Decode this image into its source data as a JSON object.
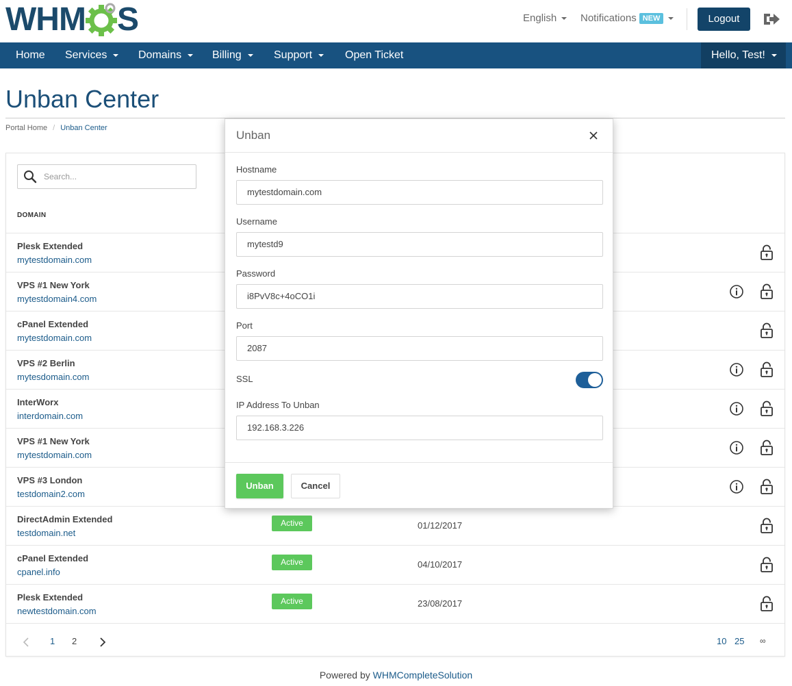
{
  "header": {
    "logo_text_left": "WHM",
    "logo_text_right": "S",
    "language": "English",
    "notifications": "Notifications",
    "new_badge": "NEW",
    "logout": "Logout"
  },
  "nav": {
    "items": [
      {
        "label": "Home",
        "dropdown": false
      },
      {
        "label": "Services",
        "dropdown": true
      },
      {
        "label": "Domains",
        "dropdown": true
      },
      {
        "label": "Billing",
        "dropdown": true
      },
      {
        "label": "Support",
        "dropdown": true
      },
      {
        "label": "Open Ticket",
        "dropdown": false
      }
    ],
    "user": "Hello, Test!"
  },
  "page": {
    "title": "Unban Center",
    "breadcrumb": [
      "Portal Home",
      "Unban Center"
    ]
  },
  "table": {
    "search_placeholder": "Search...",
    "column_domain": "DOMAIN",
    "rows": [
      {
        "name": "Plesk Extended",
        "domain": "mytestdomain.com",
        "status": "",
        "date": "",
        "info": false
      },
      {
        "name": "VPS #1 New York",
        "domain": "mytestdomain4.com",
        "status": "",
        "date": "",
        "info": true
      },
      {
        "name": "cPanel Extended",
        "domain": "mytestdomain.com",
        "status": "",
        "date": "",
        "info": false
      },
      {
        "name": "VPS #2 Berlin",
        "domain": "mytesdomain.com",
        "status": "",
        "date": "",
        "info": true
      },
      {
        "name": "InterWorx",
        "domain": "interdomain.com",
        "status": "",
        "date": "",
        "info": true
      },
      {
        "name": "VPS #1 New York",
        "domain": "mytestdomain.com",
        "status": "",
        "date": "",
        "info": true
      },
      {
        "name": "VPS #3 London",
        "domain": "testdomain2.com",
        "status": "",
        "date": "",
        "info": true
      },
      {
        "name": "DirectAdmin Extended",
        "domain": "testdomain.net",
        "status": "Active",
        "date": "01/12/2017",
        "info": false
      },
      {
        "name": "cPanel Extended",
        "domain": "cpanel.info",
        "status": "Active",
        "date": "04/10/2017",
        "info": false
      },
      {
        "name": "Plesk Extended",
        "domain": "newtestdomain.com",
        "status": "Active",
        "date": "23/08/2017",
        "info": false
      }
    ],
    "pagination": {
      "pages": [
        "1",
        "2"
      ],
      "current": "1",
      "sizes": [
        "10",
        "25",
        "∞"
      ]
    }
  },
  "footer": {
    "prefix": "Powered by",
    "link": "WHMCompleteSolution"
  },
  "modal": {
    "title": "Unban",
    "hostname_label": "Hostname",
    "hostname_value": "mytestdomain.com",
    "username_label": "Username",
    "username_value": "mytestd9",
    "password_label": "Password",
    "password_value": "i8PvV8c+4oCO1i",
    "port_label": "Port",
    "port_value": "2087",
    "ssl_label": "SSL",
    "ssl_enabled": true,
    "ip_label": "IP Address To Unban",
    "ip_value": "192.168.3.226",
    "unban_button": "Unban",
    "cancel_button": "Cancel"
  },
  "colors": {
    "brand_dark": "#1b4a6b",
    "nav_bg": "#185280",
    "logo_green": "#6cc04a",
    "success": "#5cc85c",
    "link": "#1b5b8a",
    "toggle": "#1e5f99"
  }
}
